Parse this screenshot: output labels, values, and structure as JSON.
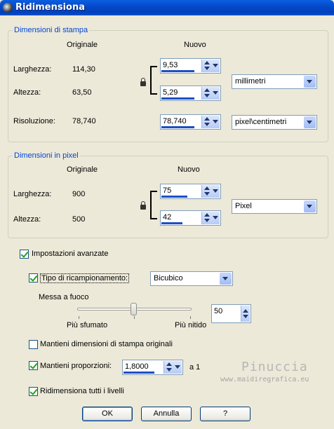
{
  "window": {
    "title": "Ridimensiona"
  },
  "print_size": {
    "group_title": "Dimensioni di stampa",
    "col_original": "Originale",
    "col_new": "Nuovo",
    "width_label": "Larghezza:",
    "width_original": "114,30",
    "width_new": "9,53",
    "height_label": "Altezza:",
    "height_original": "63,50",
    "height_new": "5,29",
    "units": "millimetri",
    "resolution_label": "Risoluzione:",
    "resolution_original": "78,740",
    "resolution_new": "78,740",
    "resolution_units": "pixel\\centimetri"
  },
  "pixel_size": {
    "group_title": "Dimensioni in pixel",
    "col_original": "Originale",
    "col_new": "Nuovo",
    "width_label": "Larghezza:",
    "width_original": "900",
    "width_new": "75",
    "height_label": "Altezza:",
    "height_original": "500",
    "height_new": "42",
    "units": "Pixel"
  },
  "advanced": {
    "advanced_label": "Impostazioni avanzate",
    "advanced_checked": true,
    "resample_label": "Tipo di ricampionamento:",
    "resample_checked": true,
    "resample_method": "Bicubico",
    "sharpness_label": "Messa a fuoco",
    "sharpness_min_label": "Più sfumato",
    "sharpness_max_label": "Più nitido",
    "sharpness_value": "50",
    "keep_print_size_label": "Mantieni dimensioni di stampa originali",
    "keep_print_size_checked": false,
    "keep_ratio_label": "Mantieni proporzioni:",
    "keep_ratio_checked": true,
    "ratio_value": "1,8000",
    "ratio_suffix": "a 1",
    "resize_all_layers_label": "Ridimensiona tutti i livelli",
    "resize_all_layers_checked": true
  },
  "buttons": {
    "ok": "OK",
    "cancel": "Annulla",
    "help": "?"
  },
  "watermark": {
    "name": "Pinuccia",
    "url": "www.maidiregrafica.eu"
  }
}
